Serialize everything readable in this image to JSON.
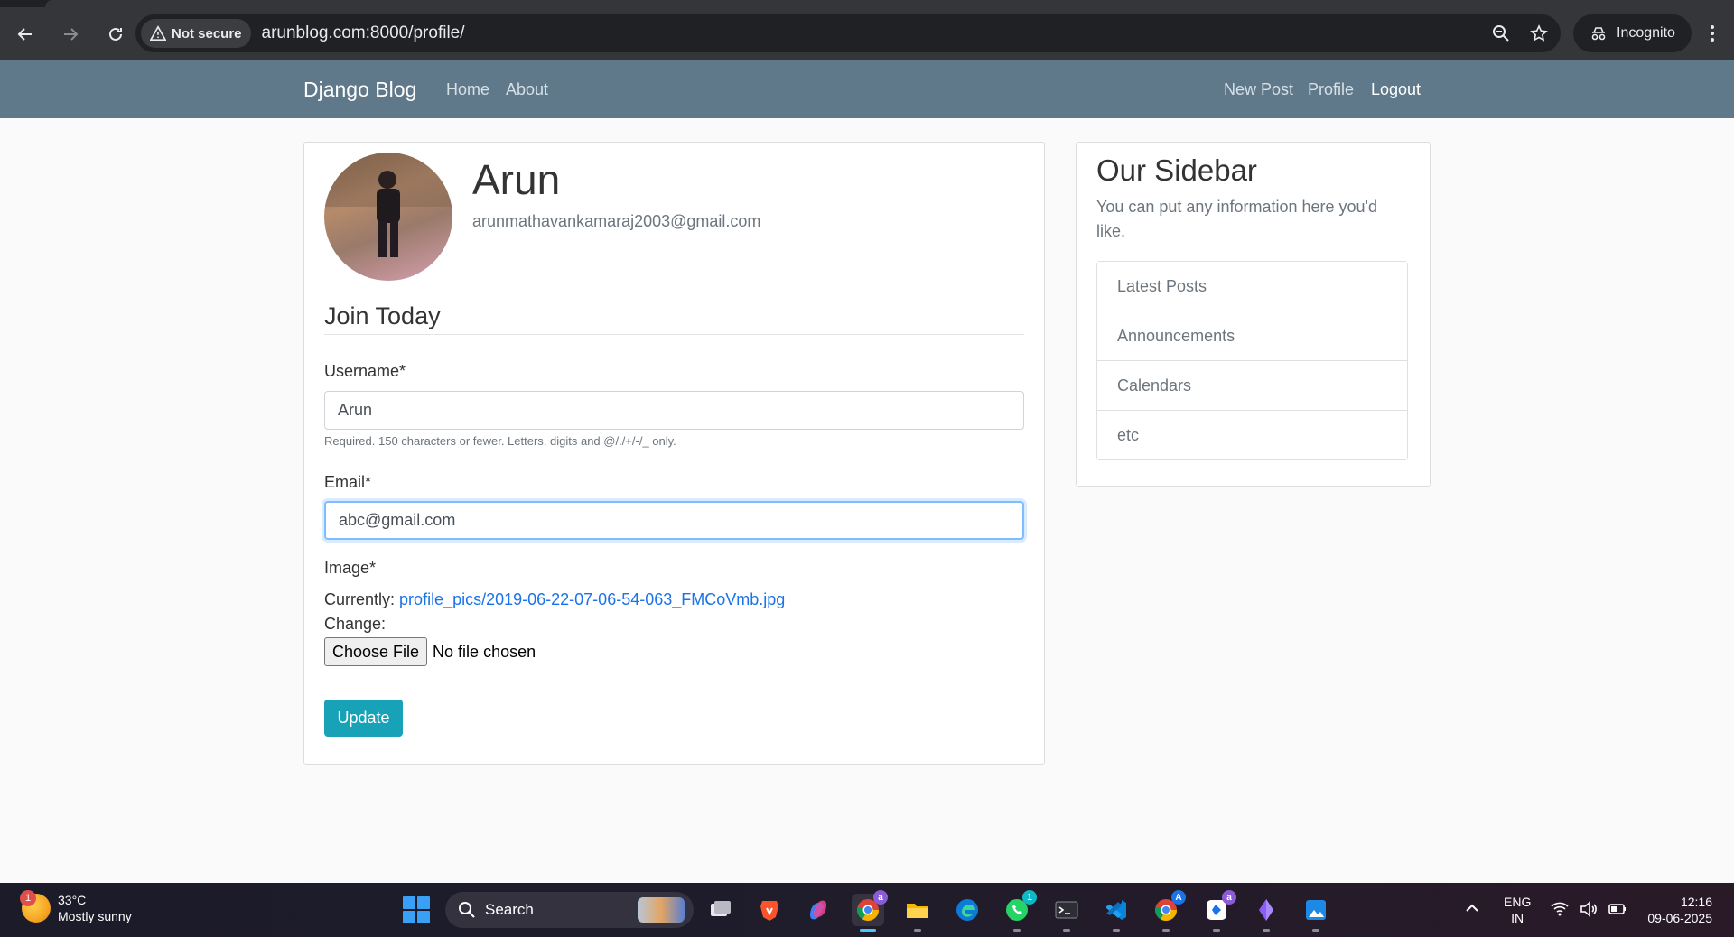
{
  "browser": {
    "security_label": "Not secure",
    "url": "arunblog.com:8000/profile/",
    "incognito_label": "Incognito"
  },
  "navbar": {
    "brand": "Django Blog",
    "left_links": [
      "Home",
      "About"
    ],
    "right_links": [
      "New Post",
      "Profile",
      "Logout"
    ]
  },
  "profile": {
    "name": "Arun",
    "email": "arunmathavankamaraj2003@gmail.com"
  },
  "form": {
    "legend": "Join Today",
    "username_label": "Username*",
    "username_value": "Arun",
    "username_help": "Required. 150 characters or fewer. Letters, digits and @/./+/-/_ only.",
    "email_label": "Email*",
    "email_value": "abc@gmail.com",
    "image_label": "Image*",
    "currently_label": "Currently:",
    "current_image": "profile_pics/2019-06-22-07-06-54-063_FMCoVmb.jpg",
    "change_label": "Change:",
    "choose_file_label": "Choose File",
    "no_file_label": "No file chosen",
    "submit_label": "Update"
  },
  "sidebar": {
    "title": "Our Sidebar",
    "description": "You can put any information here you'd like.",
    "items": [
      "Latest Posts",
      "Announcements",
      "Calendars",
      "etc"
    ]
  },
  "taskbar": {
    "weather_temp": "33°C",
    "weather_desc": "Mostly sunny",
    "weather_badge": "1",
    "search_label": "Search",
    "whatsapp_badge": "1",
    "lang_top": "ENG",
    "lang_bottom": "IN",
    "time": "12:16",
    "date": "09-06-2025"
  },
  "colors": {
    "navbar": "#5f788a",
    "update_button": "#17a2b8",
    "link": "#1a73e8"
  }
}
